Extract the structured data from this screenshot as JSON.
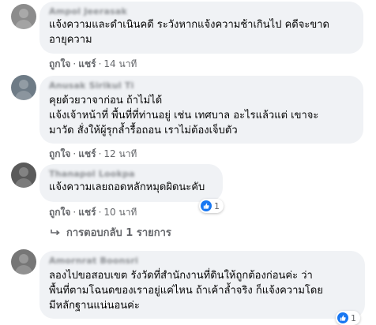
{
  "comments": [
    {
      "author": "Ampol Jeerasak",
      "lines": [
        "แจ้งความและดำเนินคดี ระวังหากแจ้งความช้าเกินไป คดีจะขาด",
        "อายุความ"
      ],
      "like": "ถูกใจ",
      "share": "แชร์",
      "time": "14 นาที"
    },
    {
      "author": "Anusak Sirikul Ti",
      "lines": [
        "คุยด้วยวาจาก่อน ถ้าไม่ได้",
        "แจ้งเจ้าหน้าที่ พื้นที่ที่ท่านอยู่ เช่น เทศบาล อะไรแล้วแต่ เขาจะ",
        "มาวัด สั่งให้ผู้รุกล้ำรื้อถอน เราไม่ต้องเจ็บตัว"
      ],
      "like": "ถูกใจ",
      "share": "แชร์",
      "time": "12 นาที"
    },
    {
      "author": "Thanapol Lookpa",
      "lines": [
        "แจ้งความเลยถอดหลักหมุดผิดนะคับ"
      ],
      "like": "ถูกใจ",
      "share": "แชร์",
      "time": "10 นาที",
      "reaction_count": "1"
    },
    {
      "author": "Amornrat Boonsri",
      "lines": [
        "ลองไปขอสอบเขต รังวัดที่สำนักงานที่ดินให้ถูกต้องก่อนค่ะ ว่า",
        "พื้นที่ตามโฉนดของเราอยู่แค่ไหน ถ้าเค้าล้ำจริง ก็แจ้งความโดย",
        "มีหลักฐานแน่นอนค่ะ"
      ],
      "reaction_count": "1"
    }
  ],
  "replies_link": "การตอบกลับ 1 รายการ",
  "separator": "·",
  "colors": {
    "bubble": "#f0f2f5",
    "like_blue": "#1877f2",
    "meta_text": "#65676b"
  }
}
